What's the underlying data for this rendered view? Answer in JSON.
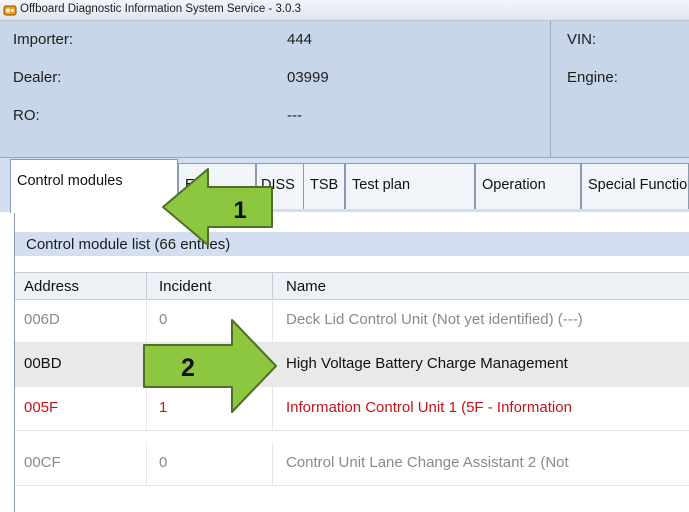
{
  "window": {
    "title": "Offboard Diagnostic Information System Service - 3.0.3"
  },
  "info": {
    "importer_label": "Importer:",
    "importer_value": "444",
    "dealer_label": "Dealer:",
    "dealer_value": "03999",
    "ro_label": "RO:",
    "ro_value": "---",
    "vin_label": "VIN:",
    "engine_label": "Engine:"
  },
  "tabs": [
    "Control modules",
    "Eq",
    "DISS",
    "TSB",
    "Test plan",
    "Operation",
    "Special Functions"
  ],
  "list": {
    "title": "Control module list (66 entries)",
    "columns": [
      "Address",
      "Incident",
      "Name"
    ],
    "rows": [
      {
        "address": "006D",
        "incident": "0",
        "name": "Deck Lid Control Unit (Not yet identified) (---)",
        "state": "dimmed"
      },
      {
        "address": "00BD",
        "incident": "",
        "name": "High Voltage Battery Charge Management",
        "state": "selected"
      },
      {
        "address": "005F",
        "incident": "1",
        "name": "Information Control Unit 1 (5F - Information",
        "state": "fault"
      },
      {
        "address": "00CF",
        "incident": "0",
        "name": "Control Unit Lane Change Assistant 2 (Not",
        "state": "dimmed"
      }
    ]
  },
  "callouts": {
    "arrow_1": "1",
    "arrow_2": "2"
  },
  "colors": {
    "header_blue": "#c7d6e8",
    "fault_red": "#c4141b",
    "dimmed_gray": "#8a8a8a",
    "callout_green": "#8dc63f",
    "callout_outline": "#4f6e2a"
  }
}
